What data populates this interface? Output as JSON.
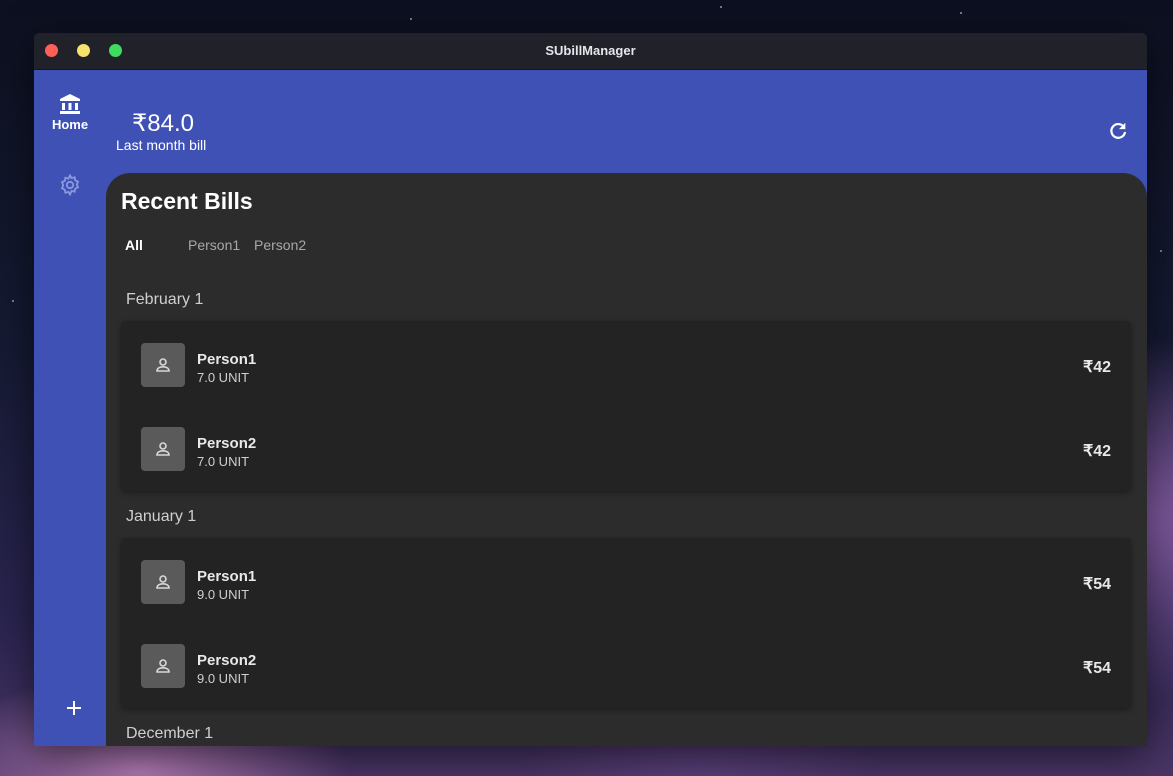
{
  "window": {
    "title": "SUbillManager"
  },
  "sidebar": {
    "home": {
      "label": "Home",
      "icon": "bank-icon"
    },
    "settings": {
      "icon": "gear-icon"
    },
    "add": {
      "icon": "plus-icon"
    }
  },
  "header": {
    "amount": "₹84.0",
    "subtitle": "Last month bill",
    "refresh_icon": "refresh-icon"
  },
  "colors": {
    "accent": "#3f51b5",
    "panel": "#2c2c2c",
    "card": "#232323",
    "titlebar": "#21212a"
  },
  "recent": {
    "title": "Recent Bills",
    "tabs": [
      {
        "label": "All",
        "active": true
      },
      {
        "label": "Person1",
        "active": false
      },
      {
        "label": "Person2",
        "active": false
      }
    ],
    "groups": [
      {
        "label": "February 1",
        "rows": [
          {
            "name": "Person1",
            "units": "7.0 UNIT",
            "amount": "₹42"
          },
          {
            "name": "Person2",
            "units": "7.0 UNIT",
            "amount": "₹42"
          }
        ]
      },
      {
        "label": "January 1",
        "rows": [
          {
            "name": "Person1",
            "units": "9.0 UNIT",
            "amount": "₹54"
          },
          {
            "name": "Person2",
            "units": "9.0 UNIT",
            "amount": "₹54"
          }
        ]
      },
      {
        "label": "December 1",
        "rows": []
      }
    ]
  }
}
